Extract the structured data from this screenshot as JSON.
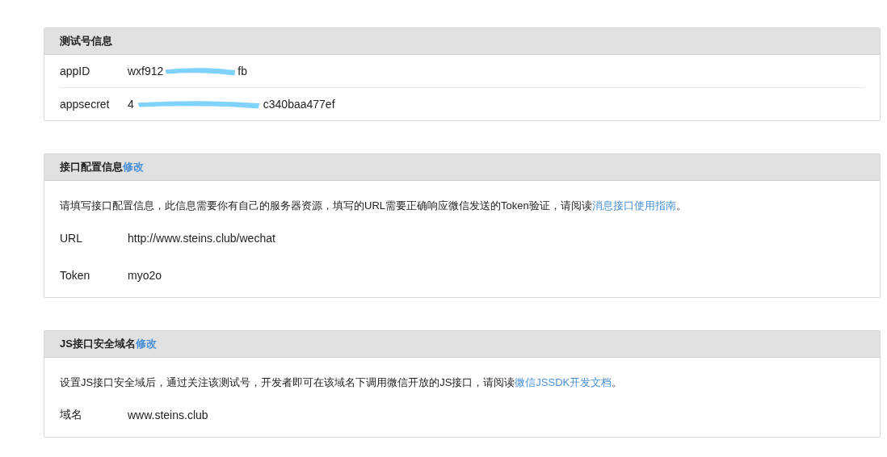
{
  "sections": [
    {
      "kind": "table",
      "title": "测试号信息",
      "fields": [
        {
          "label": "appID",
          "segments": [
            {
              "kind": "text",
              "text": "wxf912"
            },
            {
              "kind": "redaction"
            },
            {
              "kind": "text",
              "text": "fb"
            }
          ]
        },
        {
          "label": "appsecret",
          "segments": [
            {
              "kind": "text",
              "text": "4"
            },
            {
              "kind": "redaction"
            },
            {
              "kind": "text",
              "text": "c340baa477ef"
            }
          ]
        }
      ]
    },
    {
      "kind": "form",
      "title": "接口配置信息",
      "edit_link": "修改",
      "description": {
        "text": "请填写接口配置信息，此信息需要你有自己的服务器资源，填写的URL需要正确响应微信发送的Token验证，请阅读",
        "link": "消息接口使用指南",
        "after": "。"
      },
      "fields": [
        {
          "label": "URL",
          "segments": [
            {
              "kind": "text",
              "text": "http://www.steins.club/wechat"
            }
          ]
        },
        {
          "label": "Token",
          "segments": [
            {
              "kind": "text",
              "text": "myo2o"
            }
          ]
        }
      ]
    },
    {
      "kind": "form",
      "title": "JS接口安全域名",
      "edit_link": "修改",
      "description": {
        "text": "设置JS接口安全域后，通过关注该测试号，开发者即可在该域名下调用微信开放的JS接口，请阅读",
        "link": "微信JSSDK开发文档",
        "after": "。"
      },
      "fields": [
        {
          "label": "域名",
          "segments": [
            {
              "kind": "text",
              "text": "www.steins.club"
            }
          ]
        }
      ]
    }
  ]
}
